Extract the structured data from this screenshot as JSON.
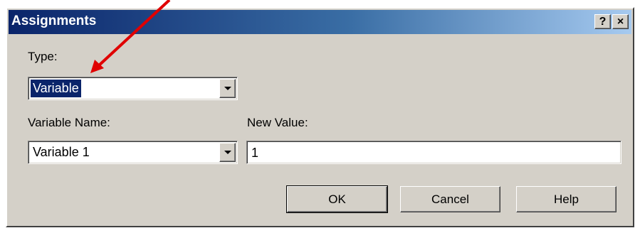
{
  "window": {
    "title": "Assignments",
    "help_label": "?",
    "close_label": "×"
  },
  "type_field": {
    "label": "Type:",
    "value": "Variable"
  },
  "variable_name_field": {
    "label": "Variable Name:",
    "value": "Variable 1"
  },
  "new_value_field": {
    "label": "New Value:",
    "value": "1"
  },
  "buttons": {
    "ok": "OK",
    "cancel": "Cancel",
    "help": "Help"
  },
  "colors": {
    "title_bar_start": "#0a246a",
    "title_bar_end": "#a6caf0",
    "dialog_face": "#d4d0c8",
    "selection": "#0a246a",
    "annotation_arrow": "#e00000"
  },
  "icons": {
    "dropdown": "chevron-down-icon",
    "annotation": "red-arrow-icon"
  }
}
